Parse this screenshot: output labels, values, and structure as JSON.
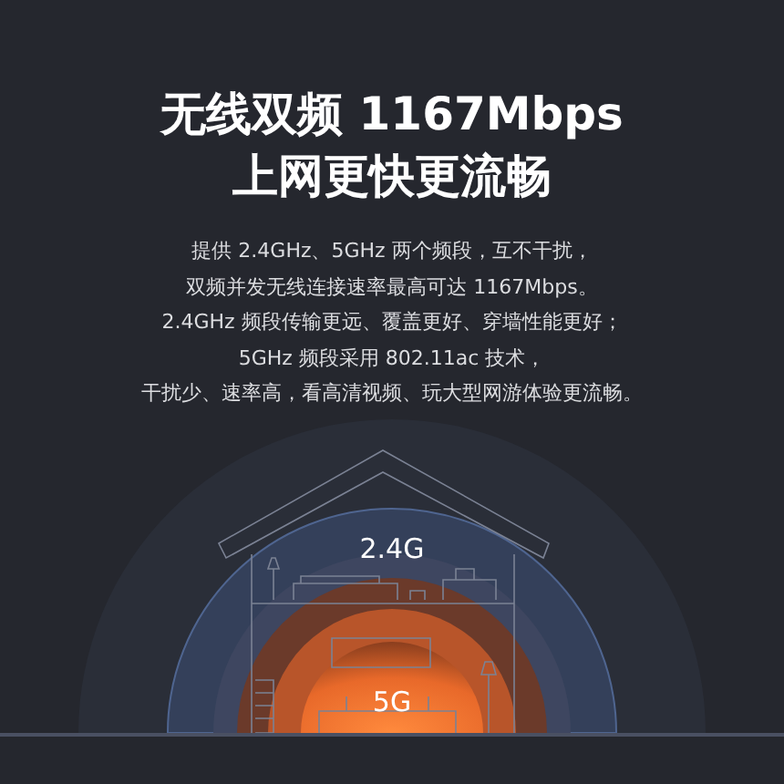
{
  "headline": [
    "无线双频 1167Mbps",
    "上网更快更流畅"
  ],
  "description": [
    "提供 2.4GHz、5GHz 两个频段，互不干扰，",
    "双频并发无线连接速率最高可达 1167Mbps。",
    "2.4GHz 频段传输更远、覆盖更好、穿墙性能更好；",
    "5GHz 频段采用 802.11ac 技术，",
    "干扰少、速率高，看高清视频、玩大型网游体验更流畅。"
  ],
  "diagram": {
    "bands": [
      {
        "label": "2.4G",
        "kind": "outer"
      },
      {
        "label": "5G",
        "kind": "inner"
      }
    ]
  }
}
